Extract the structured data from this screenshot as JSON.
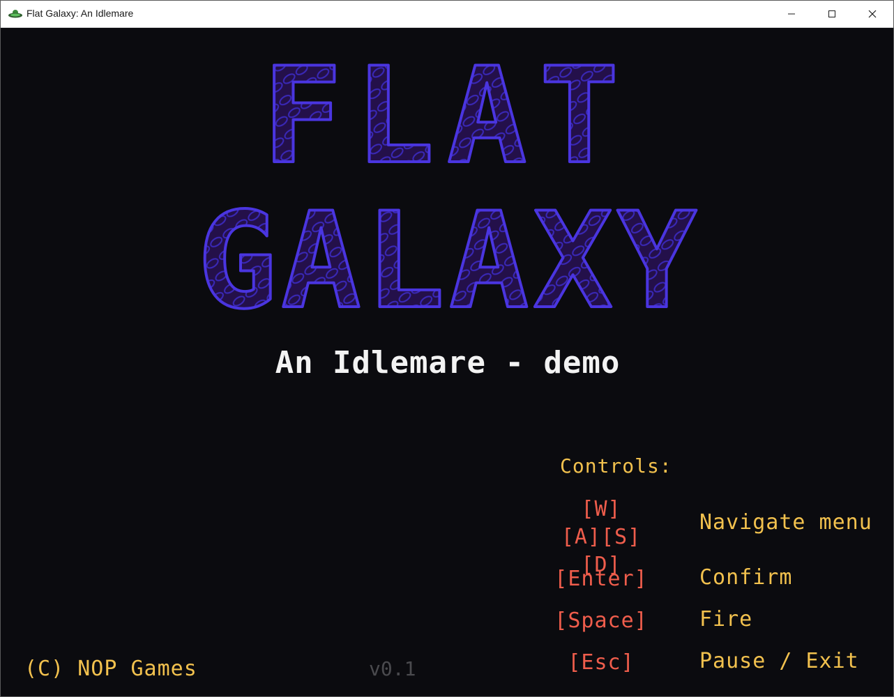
{
  "window": {
    "title": "Flat Galaxy: An Idlemare",
    "app_icon": "ufo-icon",
    "controls": {
      "minimize_icon": "minimize-icon",
      "maximize_icon": "maximize-icon",
      "close_icon": "close-icon"
    }
  },
  "title_screen": {
    "logo_line1": "FLAT",
    "logo_line2": "GALAXY",
    "logo_color": "#4a35e0",
    "logo_fill": "#24104a",
    "subtitle": "An Idlemare - demo",
    "controls_heading": "Controls:",
    "controls": [
      {
        "keys": [
          "[W]",
          "[A][S][D]"
        ],
        "action": "Navigate menu"
      },
      {
        "keys": [
          "[Enter]"
        ],
        "action": "Confirm"
      },
      {
        "keys": [
          "[Space]"
        ],
        "action": "Fire"
      },
      {
        "keys": [
          "[Esc]"
        ],
        "action": "Pause / Exit"
      }
    ],
    "copyright": "(C) NOP Games",
    "version": "v0.1"
  },
  "colors": {
    "background": "#0b0b0f",
    "key_color": "#ef5d4c",
    "label_color": "#f2c14e",
    "subtitle_color": "#f3f3f3",
    "version_color": "#4a4a4e"
  }
}
